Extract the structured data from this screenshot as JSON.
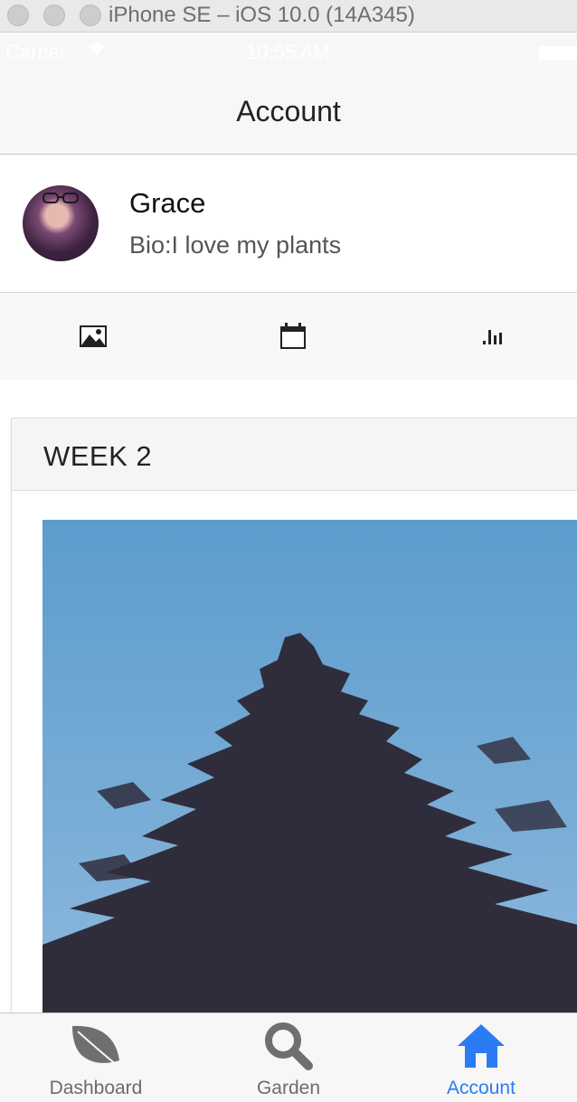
{
  "simulator": {
    "title": "iPhone SE – iOS 10.0 (14A345)"
  },
  "status_bar": {
    "carrier": "Carrier",
    "time": "10:55 AM"
  },
  "nav": {
    "title": "Account"
  },
  "profile": {
    "name": "Grace",
    "bio": "Bio:I love my plants"
  },
  "tools": [
    {
      "icon": "image-icon"
    },
    {
      "icon": "calendar-icon"
    },
    {
      "icon": "bar-chart-icon"
    }
  ],
  "card": {
    "title": "WEEK 2",
    "photo": "pine-tree-photo"
  },
  "tabs": [
    {
      "label": "Dashboard",
      "icon": "leaf-icon",
      "active": false
    },
    {
      "label": "Garden",
      "icon": "search-icon",
      "active": false
    },
    {
      "label": "Account",
      "icon": "home-icon",
      "active": true
    }
  ],
  "colors": {
    "accent": "#2b7cf4",
    "inactive": "#6b6b6b",
    "sky": "#6ea3cf",
    "tree": "#2f2d3c"
  }
}
